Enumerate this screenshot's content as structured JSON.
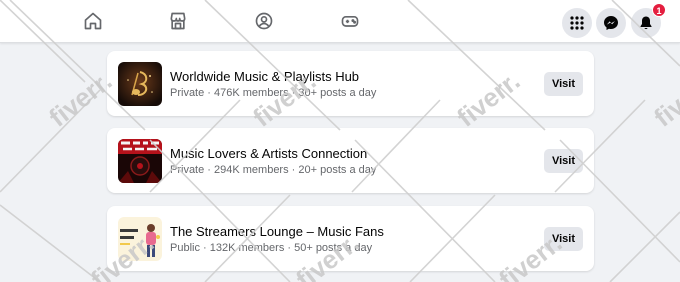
{
  "topbar": {
    "nav_icons": [
      "home-icon",
      "marketplace-icon",
      "groups-icon",
      "gaming-icon"
    ],
    "right_icons": [
      "menu-grid-icon",
      "messenger-icon",
      "notifications-icon"
    ],
    "notification_count": "1"
  },
  "groups": [
    {
      "name": "Worldwide Music & Playlists Hub",
      "meta": "Private · 476K members · 30+ posts a day",
      "visit_label": "Visit"
    },
    {
      "name": "Music Lovers & Artists Connection",
      "meta": "Private · 294K members · 20+ posts a day",
      "visit_label": "Visit"
    },
    {
      "name": "The Streamers Lounge – Music Fans",
      "meta": "Public · 132K members · 50+ posts a day",
      "visit_label": "Visit"
    }
  ],
  "watermark": {
    "text": "fiverr.",
    "color": "#c8c8c8"
  },
  "colors": {
    "background": "#f0f2f5",
    "card": "#ffffff",
    "button": "#e4e6eb",
    "badge": "#e41e3f",
    "secondary_text": "#65676b"
  }
}
